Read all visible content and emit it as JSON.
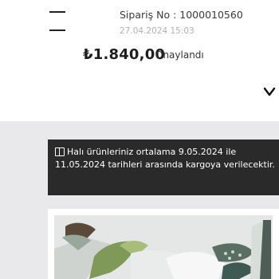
{
  "order": {
    "number_text": "Sipariş No : 1000010560",
    "date": "27.04.2024 15:03",
    "price": "₺1.840,00",
    "status": "Onaylandı"
  },
  "notice": {
    "icon": "info-box-icon",
    "text": "Halı ürünleriniz ortalama 9.05.2024 ile 11.05.2024 tarihleri arasında kargoya verilecektir."
  },
  "product": {
    "image_alt": "carpet product photo"
  },
  "colors": {
    "banner_bg": "#2a2a2a",
    "page_bg": "#e9e9ec"
  }
}
